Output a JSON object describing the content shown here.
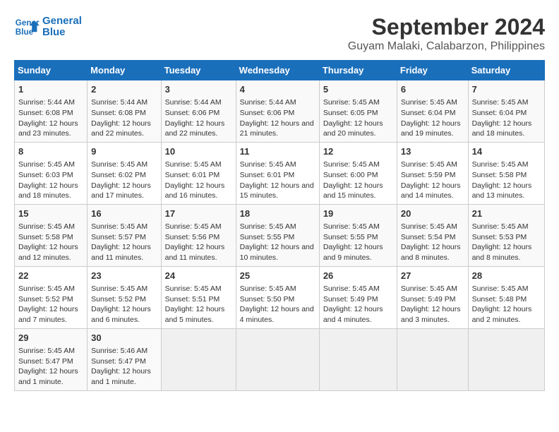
{
  "logo": {
    "line1": "General",
    "line2": "Blue"
  },
  "title": "September 2024",
  "subtitle": "Guyam Malaki, Calabarzon, Philippines",
  "days_of_week": [
    "Sunday",
    "Monday",
    "Tuesday",
    "Wednesday",
    "Thursday",
    "Friday",
    "Saturday"
  ],
  "weeks": [
    [
      {
        "day": "1",
        "sunrise": "Sunrise: 5:44 AM",
        "sunset": "Sunset: 6:08 PM",
        "daylight": "Daylight: 12 hours and 23 minutes."
      },
      {
        "day": "2",
        "sunrise": "Sunrise: 5:44 AM",
        "sunset": "Sunset: 6:08 PM",
        "daylight": "Daylight: 12 hours and 22 minutes."
      },
      {
        "day": "3",
        "sunrise": "Sunrise: 5:44 AM",
        "sunset": "Sunset: 6:06 PM",
        "daylight": "Daylight: 12 hours and 22 minutes."
      },
      {
        "day": "4",
        "sunrise": "Sunrise: 5:44 AM",
        "sunset": "Sunset: 6:06 PM",
        "daylight": "Daylight: 12 hours and 21 minutes."
      },
      {
        "day": "5",
        "sunrise": "Sunrise: 5:45 AM",
        "sunset": "Sunset: 6:05 PM",
        "daylight": "Daylight: 12 hours and 20 minutes."
      },
      {
        "day": "6",
        "sunrise": "Sunrise: 5:45 AM",
        "sunset": "Sunset: 6:04 PM",
        "daylight": "Daylight: 12 hours and 19 minutes."
      },
      {
        "day": "7",
        "sunrise": "Sunrise: 5:45 AM",
        "sunset": "Sunset: 6:04 PM",
        "daylight": "Daylight: 12 hours and 18 minutes."
      }
    ],
    [
      {
        "day": "8",
        "sunrise": "Sunrise: 5:45 AM",
        "sunset": "Sunset: 6:03 PM",
        "daylight": "Daylight: 12 hours and 18 minutes."
      },
      {
        "day": "9",
        "sunrise": "Sunrise: 5:45 AM",
        "sunset": "Sunset: 6:02 PM",
        "daylight": "Daylight: 12 hours and 17 minutes."
      },
      {
        "day": "10",
        "sunrise": "Sunrise: 5:45 AM",
        "sunset": "Sunset: 6:01 PM",
        "daylight": "Daylight: 12 hours and 16 minutes."
      },
      {
        "day": "11",
        "sunrise": "Sunrise: 5:45 AM",
        "sunset": "Sunset: 6:01 PM",
        "daylight": "Daylight: 12 hours and 15 minutes."
      },
      {
        "day": "12",
        "sunrise": "Sunrise: 5:45 AM",
        "sunset": "Sunset: 6:00 PM",
        "daylight": "Daylight: 12 hours and 15 minutes."
      },
      {
        "day": "13",
        "sunrise": "Sunrise: 5:45 AM",
        "sunset": "Sunset: 5:59 PM",
        "daylight": "Daylight: 12 hours and 14 minutes."
      },
      {
        "day": "14",
        "sunrise": "Sunrise: 5:45 AM",
        "sunset": "Sunset: 5:58 PM",
        "daylight": "Daylight: 12 hours and 13 minutes."
      }
    ],
    [
      {
        "day": "15",
        "sunrise": "Sunrise: 5:45 AM",
        "sunset": "Sunset: 5:58 PM",
        "daylight": "Daylight: 12 hours and 12 minutes."
      },
      {
        "day": "16",
        "sunrise": "Sunrise: 5:45 AM",
        "sunset": "Sunset: 5:57 PM",
        "daylight": "Daylight: 12 hours and 11 minutes."
      },
      {
        "day": "17",
        "sunrise": "Sunrise: 5:45 AM",
        "sunset": "Sunset: 5:56 PM",
        "daylight": "Daylight: 12 hours and 11 minutes."
      },
      {
        "day": "18",
        "sunrise": "Sunrise: 5:45 AM",
        "sunset": "Sunset: 5:55 PM",
        "daylight": "Daylight: 12 hours and 10 minutes."
      },
      {
        "day": "19",
        "sunrise": "Sunrise: 5:45 AM",
        "sunset": "Sunset: 5:55 PM",
        "daylight": "Daylight: 12 hours and 9 minutes."
      },
      {
        "day": "20",
        "sunrise": "Sunrise: 5:45 AM",
        "sunset": "Sunset: 5:54 PM",
        "daylight": "Daylight: 12 hours and 8 minutes."
      },
      {
        "day": "21",
        "sunrise": "Sunrise: 5:45 AM",
        "sunset": "Sunset: 5:53 PM",
        "daylight": "Daylight: 12 hours and 8 minutes."
      }
    ],
    [
      {
        "day": "22",
        "sunrise": "Sunrise: 5:45 AM",
        "sunset": "Sunset: 5:52 PM",
        "daylight": "Daylight: 12 hours and 7 minutes."
      },
      {
        "day": "23",
        "sunrise": "Sunrise: 5:45 AM",
        "sunset": "Sunset: 5:52 PM",
        "daylight": "Daylight: 12 hours and 6 minutes."
      },
      {
        "day": "24",
        "sunrise": "Sunrise: 5:45 AM",
        "sunset": "Sunset: 5:51 PM",
        "daylight": "Daylight: 12 hours and 5 minutes."
      },
      {
        "day": "25",
        "sunrise": "Sunrise: 5:45 AM",
        "sunset": "Sunset: 5:50 PM",
        "daylight": "Daylight: 12 hours and 4 minutes."
      },
      {
        "day": "26",
        "sunrise": "Sunrise: 5:45 AM",
        "sunset": "Sunset: 5:49 PM",
        "daylight": "Daylight: 12 hours and 4 minutes."
      },
      {
        "day": "27",
        "sunrise": "Sunrise: 5:45 AM",
        "sunset": "Sunset: 5:49 PM",
        "daylight": "Daylight: 12 hours and 3 minutes."
      },
      {
        "day": "28",
        "sunrise": "Sunrise: 5:45 AM",
        "sunset": "Sunset: 5:48 PM",
        "daylight": "Daylight: 12 hours and 2 minutes."
      }
    ],
    [
      {
        "day": "29",
        "sunrise": "Sunrise: 5:45 AM",
        "sunset": "Sunset: 5:47 PM",
        "daylight": "Daylight: 12 hours and 1 minute."
      },
      {
        "day": "30",
        "sunrise": "Sunrise: 5:46 AM",
        "sunset": "Sunset: 5:47 PM",
        "daylight": "Daylight: 12 hours and 1 minute."
      },
      null,
      null,
      null,
      null,
      null
    ]
  ]
}
